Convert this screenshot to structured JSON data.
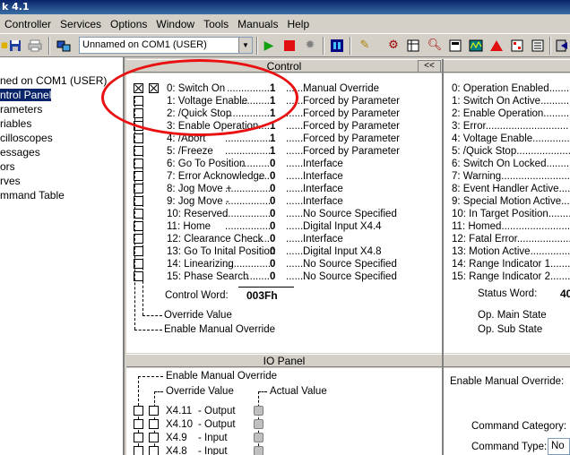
{
  "window": {
    "title": "k 4.1"
  },
  "menu": [
    "Controller",
    "Services",
    "Options",
    "Window",
    "Tools",
    "Manuals",
    "Help"
  ],
  "toolbar": {
    "device": "Unnamed on COM1 (USER)"
  },
  "tree": {
    "items": [
      "ned on COM1 (USER)",
      "ntrol Panel",
      "rameters",
      "riables",
      "cilloscopes",
      "essages",
      "ors",
      "rves",
      "mmand Table"
    ],
    "selected_index": 1
  },
  "control": {
    "header": "Control",
    "collapse_label": "<<",
    "rows": [
      {
        "label": "0: Switch On",
        "dots": "...............",
        "value": "1",
        "lead": ".......",
        "source": "Manual Override",
        "override": true,
        "enable": true
      },
      {
        "label": "1: Voltage Enable",
        "dots": "..........",
        "value": "1",
        "lead": ".......",
        "source": "Forced by Parameter",
        "override": false,
        "enable": false
      },
      {
        "label": "2: /Quick Stop",
        "dots": "...............",
        "value": "1",
        "lead": ".......",
        "source": "Forced by Parameter",
        "override": false,
        "enable": false
      },
      {
        "label": "3: Enable Operation",
        "dots": "........",
        "value": "1",
        "lead": ".......",
        "source": "Forced by Parameter",
        "override": false,
        "enable": false
      },
      {
        "label": "4: /Abort",
        "dots": "......................",
        "value": "1",
        "lead": ".......",
        "source": "Forced by Parameter",
        "override": false,
        "enable": false
      },
      {
        "label": "5: /Freeze",
        "dots": "......................",
        "value": "1",
        "lead": ".......",
        "source": "Forced by Parameter",
        "override": false,
        "enable": false
      },
      {
        "label": "6: Go To Position",
        "dots": "..........",
        "value": "0",
        "lead": ".......",
        "source": "Interface",
        "override": false,
        "enable": false
      },
      {
        "label": "7: Error Acknowledge",
        "dots": "....",
        "value": "0",
        "lead": ".......",
        "source": "Interface",
        "override": false,
        "enable": false
      },
      {
        "label": "8: Jog Move +",
        "dots": "................",
        "value": "0",
        "lead": ".......",
        "source": "Interface",
        "override": false,
        "enable": false
      },
      {
        "label": "9: Jog Move -",
        "dots": ".................",
        "value": "0",
        "lead": ".......",
        "source": "Interface",
        "override": false,
        "enable": false
      },
      {
        "label": "10: Reserved",
        "dots": "...................",
        "value": "0",
        "lead": ".......",
        "source": "No Source Specified",
        "override": false,
        "enable": false
      },
      {
        "label": "11: Home",
        "dots": "........................",
        "value": "0",
        "lead": ".......",
        "source": "Digital Input X4.4",
        "override": false,
        "enable": false
      },
      {
        "label": "12: Clearance Check",
        "dots": ".......",
        "value": "0",
        "lead": ".......",
        "source": "Interface",
        "override": false,
        "enable": false
      },
      {
        "label": "13: Go To Inital Position",
        "dots": "",
        "value": "0",
        "lead": ".......",
        "source": "Digital Input X4.8",
        "override": false,
        "enable": false
      },
      {
        "label": "14: Linearizing",
        "dots": "................",
        "value": "0",
        "lead": ".......",
        "source": "No Source Specified",
        "override": false,
        "enable": false
      },
      {
        "label": "15: Phase Search",
        "dots": ".........",
        "value": "0",
        "lead": ".......",
        "source": "No Source Specified",
        "override": false,
        "enable": false
      }
    ],
    "control_word_label": "Control Word:",
    "control_word_value": "003Fh",
    "override_value_label": "Override Value",
    "enable_manual_override_label": "Enable Manual Override"
  },
  "status": {
    "rows": [
      "0: Operation Enabled..........",
      "1: Switch On Active...........",
      "2: Enable Operation...........",
      "3: Error.............................",
      "4: Voltage Enable..............",
      "5: /Quick Stop....................",
      "6: Switch On Locked..........",
      "7: Warning.........................",
      "8: Event Handler Active......",
      "9: Special Motion Active.....",
      "10: In Target Position.........",
      "11: Homed..........................",
      "12: Fatal Error....................",
      "13: Motion Active...............",
      "14: Range Indicator 1.........",
      "15: Range Indicator 2........."
    ],
    "status_word_label": "Status Word:",
    "status_word_value": "40",
    "main_state_label": "Op. Main State",
    "sub_state_label": "Op. Sub State"
  },
  "io": {
    "header": "IO Panel",
    "enable_manual_override_label": "Enable Manual Override",
    "override_value_label": "Override Value",
    "actual_value_label": "Actual Value",
    "rows": [
      {
        "name": "X4.11",
        "type": "- Output"
      },
      {
        "name": "X4.10",
        "type": "- Output"
      },
      {
        "name": "X4.9",
        "type": "- Input"
      },
      {
        "name": "X4.8",
        "type": "- Input"
      }
    ]
  },
  "right_lower": {
    "enable_manual_override_label": "Enable Manual Override:",
    "command_category_label": "Command Category:",
    "command_type_label": "Command Type:",
    "command_type_value": "No C"
  }
}
